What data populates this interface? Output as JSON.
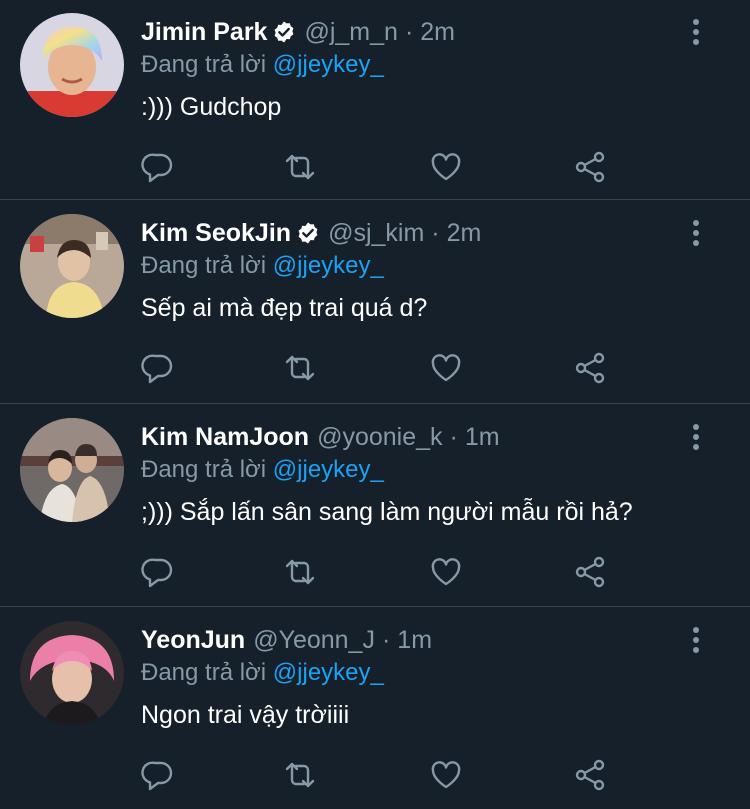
{
  "tweets": [
    {
      "name": "Jimin Park",
      "verified": true,
      "handle": "@j_m_n",
      "dot": "·",
      "time": "2m",
      "replying_prefix": "Đang trả lời ",
      "replying_to": "@jjeykey_",
      "text": ":))) Gudchop"
    },
    {
      "name": "Kim SeokJin",
      "verified": true,
      "handle": "@sj_kim",
      "dot": "·",
      "time": "2m",
      "replying_prefix": "Đang trả lời ",
      "replying_to": "@jjeykey_",
      "text": "Sếp ai mà đẹp trai quá d?"
    },
    {
      "name": "Kim NamJoon",
      "verified": false,
      "handle": "@yoonie_k",
      "dot": "·",
      "time": "1m",
      "replying_prefix": "Đang trả lời ",
      "replying_to": "@jjeykey_",
      "text": ";))) Sắp lấn sân sang làm người mẫu rồi hả?"
    },
    {
      "name": "YeonJun",
      "verified": false,
      "handle": "@Yeonn_J",
      "dot": "·",
      "time": "1m",
      "replying_prefix": "Đang trả lời ",
      "replying_to": "@jjeykey_",
      "text": "Ngon trai vậy trờiiii"
    }
  ],
  "icons": [
    "reply-icon",
    "retweet-icon",
    "like-icon",
    "share-icon",
    "more-icon",
    "verified-badge-icon"
  ],
  "colors": {
    "background": "#15202b",
    "divider": "#38444d",
    "secondary_text": "#8899a6",
    "accent": "#1da1f2"
  }
}
